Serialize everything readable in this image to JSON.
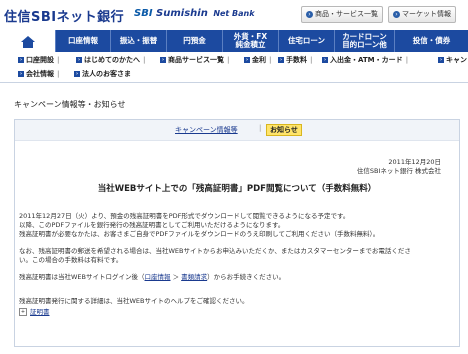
{
  "brand": {
    "logo_jp": "住信SBIネット銀行",
    "logo_en_sbi": "SBI",
    "logo_en_name": "Sumishin",
    "logo_en_suffix": "Net Bank"
  },
  "top_links": [
    {
      "label": "商品・サービス一覧"
    },
    {
      "label": "マーケット情報"
    }
  ],
  "nav": {
    "home_icon": "home-icon",
    "items": [
      {
        "label": "口座情報"
      },
      {
        "label": "振込・振替"
      },
      {
        "label": "円預金"
      },
      {
        "label": "外貨・FX\n純金積立"
      },
      {
        "label": "住宅ローン"
      },
      {
        "label": "カードローン\n目的ローン他"
      },
      {
        "label": "投信・債券"
      }
    ]
  },
  "subnav": {
    "row1": [
      "口座開設",
      "はじめてのかたへ",
      "商品サービス一覧",
      "金利",
      "手数料",
      "入出金・ATM・カード",
      "キャン"
    ],
    "row2": [
      "会社情報",
      "法人のお客さま"
    ]
  },
  "page": {
    "title": "キャンペーン情報等・お知らせ",
    "tab_campaign": "キャンペーン情報等",
    "tab_notice": "お知らせ",
    "date": "2011年12月20日",
    "org": "住信SBIネット銀行 株式会社",
    "headline": "当社WEBサイト上での「残高証明書」PDF閲覧について（手数料無料）",
    "para1_line1": "2011年12月27日（火）より、預金の残高証明書をPDF形式でダウンロードして閲覧できるようになる予定です。",
    "para1_line2": "以降、このPDFファイルを銀行発行の残高証明書としてご利用いただけるようになります。",
    "para1_line3": "残高証明書が必要なかたは、お客さまご自身でPDFファイルをダウンロードのうえ印刷してご利用ください（手数料無料）。",
    "para2_line1": "なお、残高証明書の郵送を希望される場合は、当社WEBサイトからお申込みいただくか、またはカスタマーセンターまでお電話くださ",
    "para2_line2": "い。この場合の手数料は有料です。",
    "para3_prefix": "残高証明書は当社WEBサイトログイン後（",
    "para3_link1": "口座情報",
    "para3_arrow": " ＞ ",
    "para3_link2": "書類請求",
    "para3_suffix": "）からお手続きください。",
    "para4": "残高証明書発行に関する詳細は、当社WEBサイトのヘルプをご確認ください。",
    "help_link": "証明書"
  }
}
